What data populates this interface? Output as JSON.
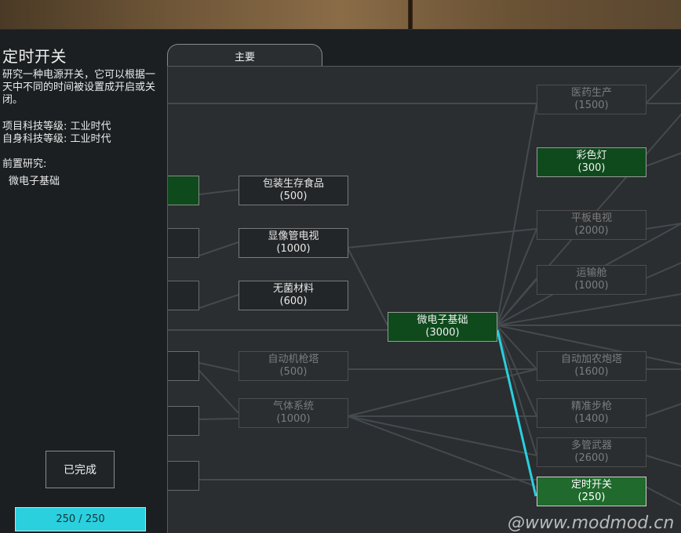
{
  "detail": {
    "title": "定时开关",
    "description": "研究一种电源开关，它可以根据一天中不同的时间被设置成开启或关闭。",
    "project_tech_level": "项目科技等级: 工业时代",
    "self_tech_level": "自身科技等级: 工业时代",
    "prereq_heading": "前置研究:",
    "prereq_item": "微电子基础",
    "done_label": "已完成",
    "progress_text": "250 / 250",
    "progress_fraction": 1.0
  },
  "tabs": [
    {
      "label": "主要"
    }
  ],
  "nodes": {
    "food": {
      "name": "包装生存食品",
      "cost": "(500)"
    },
    "crt": {
      "name": "显像管电视",
      "cost": "(1000)"
    },
    "sterile": {
      "name": "无菌材料",
      "cost": "(600)"
    },
    "turret": {
      "name": "自动机枪塔",
      "cost": "(500)"
    },
    "gas": {
      "name": "气体系统",
      "cost": "(1000)"
    },
    "micro": {
      "name": "微电子基础",
      "cost": "(3000)"
    },
    "med": {
      "name": "医药生产",
      "cost": "(1500)"
    },
    "colorlight": {
      "name": "彩色灯",
      "cost": "(300)"
    },
    "flattv": {
      "name": "平板电视",
      "cost": "(2000)"
    },
    "pod": {
      "name": "运输舱",
      "cost": "(1000)"
    },
    "autocannon": {
      "name": "自动加农炮塔",
      "cost": "(1600)"
    },
    "rifle": {
      "name": "精准步枪",
      "cost": "(1400)"
    },
    "minigun": {
      "name": "多管武器",
      "cost": "(2600)"
    },
    "timer": {
      "name": "定时开关",
      "cost": "(250)"
    }
  },
  "colors": {
    "completed": "#0f4a1c",
    "selected": "#1f6a2c",
    "highlight_edge": "#2ad0de",
    "progress": "#2ad0de"
  },
  "watermark": "@www.modmod.cn"
}
